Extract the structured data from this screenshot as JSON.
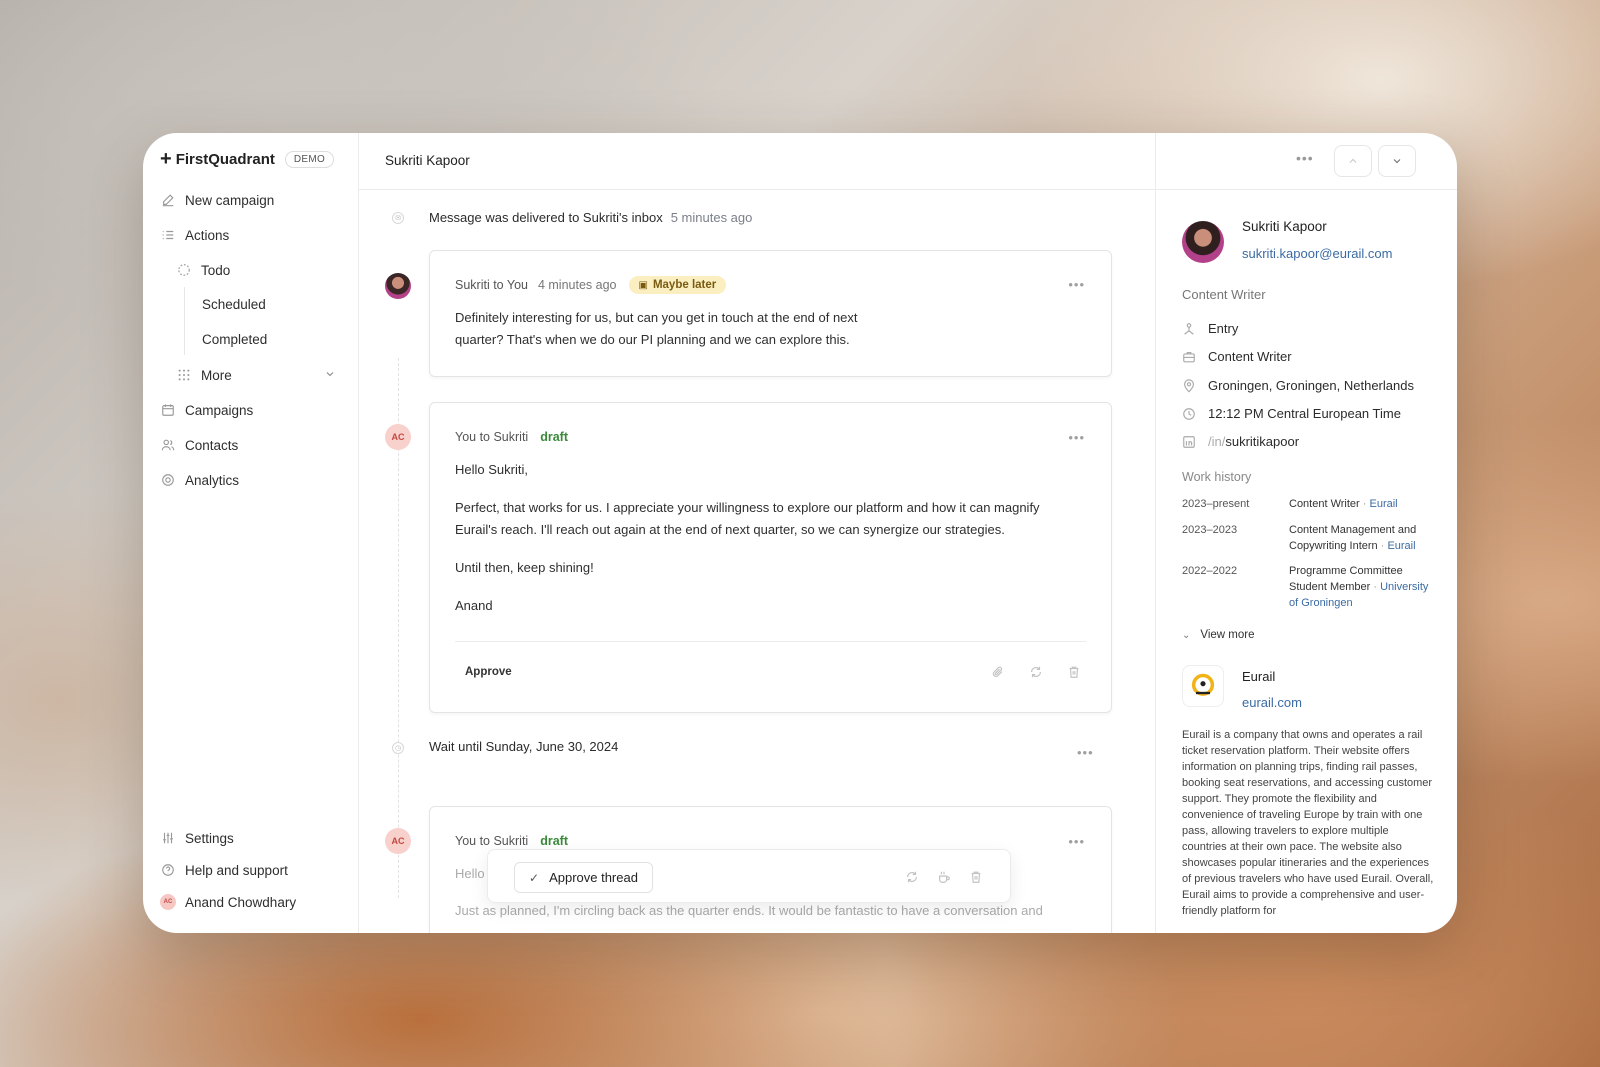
{
  "brand": {
    "name": "FirstQuadrant",
    "badge": "DEMO"
  },
  "sidebar": {
    "items": [
      {
        "label": "New campaign",
        "icon": "edit-icon"
      },
      {
        "label": "Actions",
        "icon": "list-icon"
      },
      {
        "label": "Todo",
        "icon": "dashed-circle-icon"
      },
      {
        "label": "Scheduled"
      },
      {
        "label": "Completed"
      },
      {
        "label": "More",
        "icon": "grid-dots-icon"
      },
      {
        "label": "Campaigns",
        "icon": "calendar-icon"
      },
      {
        "label": "Contacts",
        "icon": "users-icon"
      },
      {
        "label": "Analytics",
        "icon": "analytics-icon"
      }
    ],
    "bottom": [
      {
        "label": "Settings",
        "icon": "sliders-icon"
      },
      {
        "label": "Help and support",
        "icon": "help-icon"
      },
      {
        "label": "Anand Chowdhary",
        "avatar": "AC"
      }
    ]
  },
  "header": {
    "title": "Sukriti Kapoor"
  },
  "thread": {
    "delivered": {
      "text": "Message was delivered to Sukriti's inbox",
      "time": "5 minutes ago"
    },
    "reply": {
      "from": "Sukriti to You",
      "time": "4 minutes ago",
      "badge": "Maybe later",
      "line1": "Definitely interesting for us, but can you get in touch at the end of next",
      "line2": "quarter? That's when we do our PI planning and we can explore this."
    },
    "draft1": {
      "from": "You to Sukriti",
      "status": "draft",
      "avatar": "AC",
      "greeting": "Hello Sukriti,",
      "para1": "Perfect, that works for us. I appreciate your willingness to explore our platform and how it can magnify",
      "para1b": "Eurail's reach. I'll reach out again at the end of next quarter, so we can synergize our strategies.",
      "para2": "Until then, keep shining!",
      "signoff": "Anand",
      "approve": "Approve"
    },
    "wait": {
      "text": "Wait until Sunday, June 30, 2024"
    },
    "draft2": {
      "from": "You to Sukriti",
      "status": "draft",
      "avatar": "AC",
      "greeting": "Hello",
      "para1": "Just as planned, I'm circling back as the quarter ends. It would be fantastic to have a conversation and"
    },
    "approve_thread": "Approve thread"
  },
  "contact": {
    "name": "Sukriti Kapoor",
    "email": "sukriti.kapoor@eurail.com",
    "role": "Content Writer",
    "details": [
      {
        "icon": "seniority-icon",
        "text": "Entry"
      },
      {
        "icon": "briefcase-icon",
        "text": "Content Writer"
      },
      {
        "icon": "location-icon",
        "text": "Groningen, Groningen, Netherlands"
      },
      {
        "icon": "clock-icon",
        "text": "12:12 PM Central European Time"
      },
      {
        "icon": "linkedin-icon",
        "prefix": "/in/",
        "text": "sukritikapoor"
      }
    ],
    "work_history_title": "Work history",
    "work_history": [
      {
        "years": "2023–present",
        "title": "Content Writer",
        "company": "Eurail"
      },
      {
        "years": "2023–2023",
        "title": "Content Management and Copywriting Intern",
        "company": "Eurail"
      },
      {
        "years": "2022–2022",
        "title": "Programme Committee Student Member",
        "company": "University of Groningen"
      }
    ],
    "view_more": "View more",
    "company": {
      "name": "Eurail",
      "site": "eurail.com",
      "description": "Eurail is a company that owns and operates a rail ticket reservation platform. Their website offers information on planning trips, finding rail passes, booking seat reservations, and accessing customer support. They promote the flexibility and convenience of traveling Europe by train with one pass, allowing travelers to explore multiple countries at their own pace. The website also showcases popular itineraries and the experiences of previous travelers who have used Eurail. Overall, Eurail aims to provide a comprehensive and user-friendly platform for"
    }
  }
}
